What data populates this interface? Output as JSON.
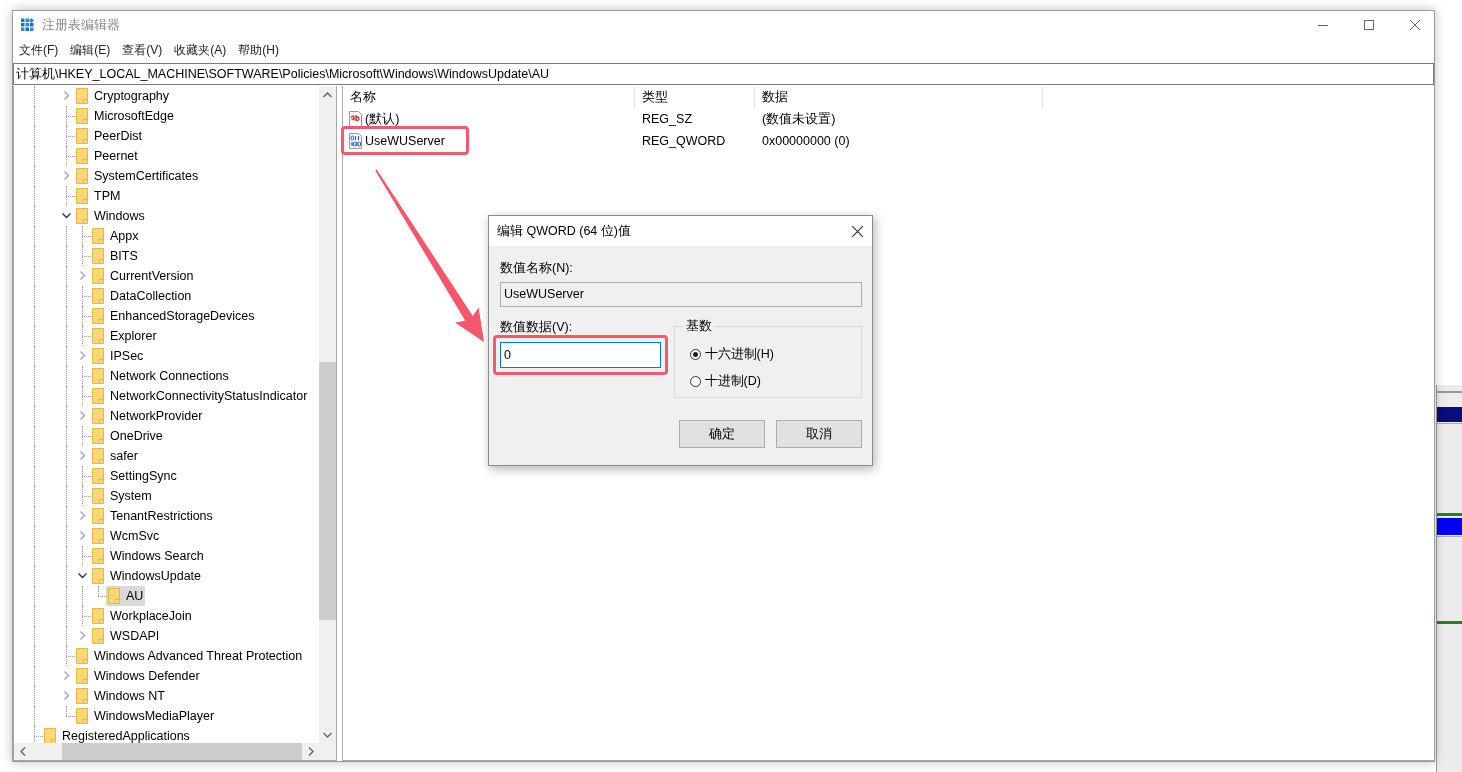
{
  "window": {
    "title": "注册表编辑器"
  },
  "menu": [
    "文件(F)",
    "编辑(E)",
    "查看(V)",
    "收藏夹(A)",
    "帮助(H)"
  ],
  "address": "计算机\\HKEY_LOCAL_MACHINE\\SOFTWARE\\Policies\\Microsoft\\Windows\\WindowsUpdate\\AU",
  "tree": {
    "branch": [
      {
        "label": "Cryptography",
        "expandable": true,
        "expanded": false,
        "selected": false
      },
      {
        "label": "MicrosoftEdge",
        "expandable": false,
        "expanded": false,
        "selected": false
      },
      {
        "label": "PeerDist",
        "expandable": false,
        "expanded": false,
        "selected": false
      },
      {
        "label": "Peernet",
        "expandable": false,
        "expanded": false,
        "selected": false
      },
      {
        "label": "SystemCertificates",
        "expandable": true,
        "expanded": false,
        "selected": false
      },
      {
        "label": "TPM",
        "expandable": false,
        "expanded": false,
        "selected": false
      },
      {
        "label": "Windows",
        "expandable": true,
        "expanded": true,
        "selected": false,
        "children": [
          {
            "label": "Appx",
            "expandable": false,
            "expanded": false,
            "selected": false
          },
          {
            "label": "BITS",
            "expandable": false,
            "expanded": false,
            "selected": false
          },
          {
            "label": "CurrentVersion",
            "expandable": true,
            "expanded": false,
            "selected": false
          },
          {
            "label": "DataCollection",
            "expandable": false,
            "expanded": false,
            "selected": false
          },
          {
            "label": "EnhancedStorageDevices",
            "expandable": false,
            "expanded": false,
            "selected": false
          },
          {
            "label": "Explorer",
            "expandable": false,
            "expanded": false,
            "selected": false
          },
          {
            "label": "IPSec",
            "expandable": true,
            "expanded": false,
            "selected": false
          },
          {
            "label": "Network Connections",
            "expandable": false,
            "expanded": false,
            "selected": false
          },
          {
            "label": "NetworkConnectivityStatusIndicator",
            "expandable": false,
            "expanded": false,
            "selected": false
          },
          {
            "label": "NetworkProvider",
            "expandable": true,
            "expanded": false,
            "selected": false
          },
          {
            "label": "OneDrive",
            "expandable": false,
            "expanded": false,
            "selected": false
          },
          {
            "label": "safer",
            "expandable": true,
            "expanded": false,
            "selected": false
          },
          {
            "label": "SettingSync",
            "expandable": false,
            "expanded": false,
            "selected": false
          },
          {
            "label": "System",
            "expandable": false,
            "expanded": false,
            "selected": false
          },
          {
            "label": "TenantRestrictions",
            "expandable": true,
            "expanded": false,
            "selected": false
          },
          {
            "label": "WcmSvc",
            "expandable": true,
            "expanded": false,
            "selected": false
          },
          {
            "label": "Windows Search",
            "expandable": false,
            "expanded": false,
            "selected": false
          },
          {
            "label": "WindowsUpdate",
            "expandable": true,
            "expanded": true,
            "selected": false,
            "children": [
              {
                "label": "AU",
                "expandable": false,
                "expanded": false,
                "selected": true
              }
            ]
          },
          {
            "label": "WorkplaceJoin",
            "expandable": false,
            "expanded": false,
            "selected": false
          },
          {
            "label": "WSDAPI",
            "expandable": true,
            "expanded": false,
            "selected": false
          }
        ]
      },
      {
        "label": "Windows Advanced Threat Protection",
        "expandable": false,
        "expanded": false,
        "selected": false
      },
      {
        "label": "Windows Defender",
        "expandable": true,
        "expanded": false,
        "selected": false
      },
      {
        "label": "Windows NT",
        "expandable": true,
        "expanded": false,
        "selected": false
      },
      {
        "label": "WindowsMediaPlayer",
        "expandable": false,
        "expanded": false,
        "selected": false
      }
    ],
    "items": [
      {
        "label": "RegisteredApplications",
        "expandable": false,
        "expanded": false,
        "selected": false
      }
    ]
  },
  "list": {
    "columns": [
      "名称",
      "类型",
      "数据"
    ],
    "rows": [
      {
        "kind": "string",
        "name": "(默认)",
        "type": "REG_SZ",
        "data": "(数值未设置)",
        "marked": false
      },
      {
        "kind": "binary",
        "name": "UseWUServer",
        "type": "REG_QWORD",
        "data": "0x00000000 (0)",
        "marked": true
      }
    ]
  },
  "dialog": {
    "title": "编辑 QWORD (64 位)值",
    "name_label": "数值名称(N):",
    "name_value": "UseWUServer",
    "data_label": "数值数据(V):",
    "data_value": "0",
    "data_focused": true,
    "data_marked": true,
    "base_label": "基数",
    "bases": [
      {
        "label": "十六进制(H)",
        "selected": true
      },
      {
        "label": "十进制(D)",
        "selected": false
      }
    ],
    "buttons": [
      "确定",
      "取消"
    ]
  },
  "annotations": [
    {
      "kind": "arrow"
    }
  ]
}
